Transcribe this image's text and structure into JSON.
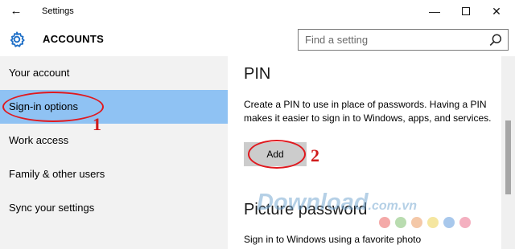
{
  "window": {
    "title": "Settings",
    "back_glyph": "←",
    "minimize_glyph": "—",
    "close_glyph": "✕"
  },
  "header": {
    "section_title": "ACCOUNTS",
    "icon": "gear-icon",
    "search_placeholder": "Find a setting"
  },
  "sidebar": {
    "items": [
      {
        "label": "Your account"
      },
      {
        "label": "Sign-in options",
        "selected": true
      },
      {
        "label": "Work access"
      },
      {
        "label": "Family & other users"
      },
      {
        "label": "Sync your settings"
      }
    ]
  },
  "main": {
    "pin": {
      "heading": "PIN",
      "description": "Create a PIN to use in place of passwords. Having a PIN makes it easier to sign in to Windows, apps, and services.",
      "add_label": "Add"
    },
    "picture_password": {
      "heading": "Picture password",
      "description": "Sign in to Windows using a favorite photo"
    }
  },
  "annotations": {
    "step_1": "1",
    "step_2": "2",
    "color": "#e0191f"
  },
  "watermark": {
    "brand": "Download",
    "suffix": ".com.vn",
    "dot_colors": [
      "#f4a9a8",
      "#b9dcb0",
      "#f4c8a8",
      "#f5e6a0",
      "#a8c8ec",
      "#f4b0c0"
    ]
  },
  "colors": {
    "sidebar_bg": "#f2f2f2",
    "selected_bg": "#8fc2f3",
    "accent": "#1e6fc7",
    "button_bg": "#cccccc"
  }
}
